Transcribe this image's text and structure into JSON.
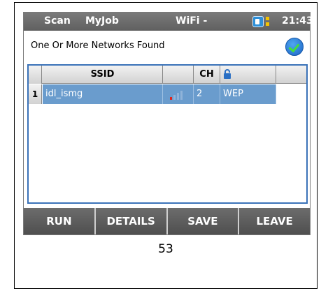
{
  "status_bar": {
    "scan": "Scan",
    "myjob": "MyJob",
    "wifi": "WiFi -",
    "time": "21:43"
  },
  "message": "One Or More Networks Found",
  "table": {
    "columns": [
      "SSID",
      "",
      "CH",
      ""
    ],
    "rows": [
      {
        "num": "1",
        "ssid": "idl_ismg",
        "channel": "2",
        "security": "WEP"
      }
    ]
  },
  "buttons": [
    "RUN",
    "DETAILS",
    "SAVE",
    "LEAVE"
  ],
  "page_number": "53",
  "colors": {
    "status_bar": "#686868",
    "selected_row": "#6a9ccd",
    "table_border": "#3a72b8",
    "check": "#1b64c5",
    "battery": "#2d8fd8"
  }
}
